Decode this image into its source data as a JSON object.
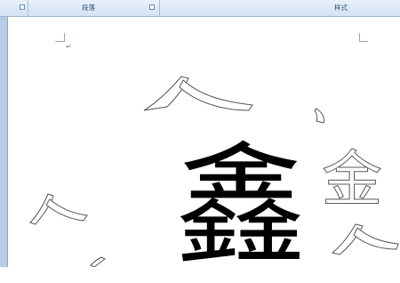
{
  "ribbon": {
    "groups": [
      {
        "label": "段落"
      },
      {
        "label": "样式"
      }
    ]
  },
  "document": {
    "main_character": "鑫",
    "paragraph_mark": "↵",
    "right_fragment_text": "金"
  },
  "colors": {
    "ribbon_bg": "#dbe7f6",
    "ribbon_label": "#2f4e7a",
    "page_bg": "#ffffff",
    "glyph": "#000000",
    "outline": "#5a5a5a"
  }
}
